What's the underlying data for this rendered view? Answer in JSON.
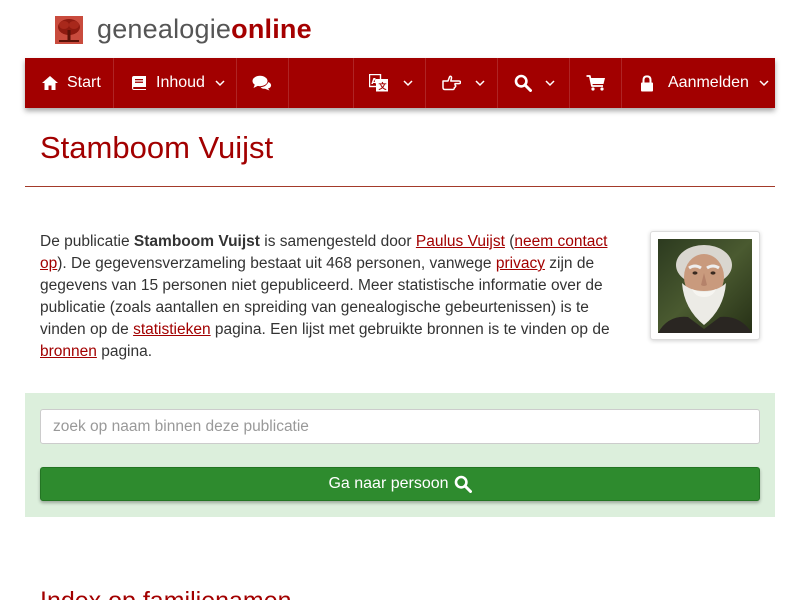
{
  "brand": {
    "name_plain": "genealogie",
    "name_strong": "online",
    "accent": "#a20000",
    "logo_icon": "family-tree-icon"
  },
  "nav": {
    "items": [
      {
        "label": "Start",
        "icon": "home-icon"
      },
      {
        "label": "Inhoud",
        "icon": "book-icon",
        "dropdown": true
      },
      {
        "label": "",
        "icon": "comments-icon"
      },
      {
        "label": "",
        "icon": "language-icon",
        "dropdown": true
      },
      {
        "label": "",
        "icon": "hand-point-icon",
        "dropdown": true
      },
      {
        "label": "",
        "icon": "search-icon",
        "dropdown": true
      },
      {
        "label": "",
        "icon": "shopping-cart-icon"
      },
      {
        "label": "Aanmelden",
        "icon": "lock-icon",
        "dropdown": true
      }
    ]
  },
  "page": {
    "title": "Stamboom Vuijst",
    "intro": {
      "t1": "De publicatie ",
      "pub_name": "Stamboom Vuijst",
      "t2": " is samengesteld door ",
      "author_link": "Paulus Vuijst",
      "t3": " (",
      "contact_link": "neem contact op",
      "t4": "). De gegevensverzameling bestaat uit 468 personen, vanwege ",
      "privacy_link": "privacy",
      "t5": " zijn de gegevens van 15 personen niet gepubliceerd. Meer statistische informatie over de publicatie (zoals aantallen en spreiding van genealogische gebeurtenissen) is te vinden op de ",
      "stats_link": "statistieken",
      "t6": " pagina. Een lijst met gebruikte bronnen is te vinden op de ",
      "sources_link": "bronnen",
      "t7": " pagina."
    },
    "portrait": "author-portrait"
  },
  "search": {
    "placeholder": "zoek op naam binnen deze publicatie",
    "value": "",
    "button_label": "Ga naar persoon",
    "bg_color": "#dcefdc",
    "button_color": "#2e8b2e"
  },
  "index": {
    "heading": "Index op familienamen"
  }
}
